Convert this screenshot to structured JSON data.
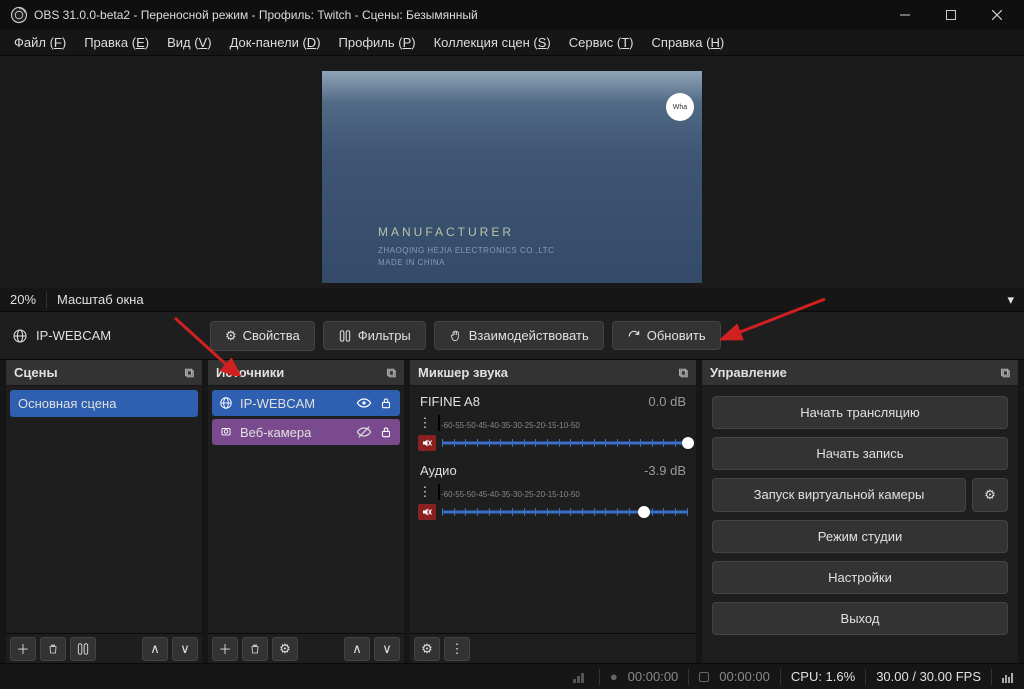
{
  "title": "OBS 31.0.0-beta2 - Переносной режим - Профиль: Twitch - Сцены: Безымянный",
  "menu": [
    "Файл (F)",
    "Правка (E)",
    "Вид (V)",
    "Док-панели (D)",
    "Профиль (P)",
    "Коллекция сцен (S)",
    "Сервис (T)",
    "Справка (H)"
  ],
  "preview": {
    "logo": "Wha",
    "mfr": "MANUFACTURER",
    "sub1": "ZHAOQING HEJIA ELECTRONICS CO.,LTC",
    "sub2": "MADE IN CHINA"
  },
  "zoom": {
    "pct": "20%",
    "label": "Масштаб окна"
  },
  "toolbar": {
    "source": "IP-WEBCAM",
    "props": "Свойства",
    "filters": "Фильтры",
    "interact": "Взаимодействовать",
    "refresh": "Обновить"
  },
  "panels": {
    "scenes": {
      "title": "Сцены",
      "items": [
        "Основная сцена"
      ]
    },
    "sources": {
      "title": "Источники",
      "items": [
        {
          "name": "IP-WEBCAM",
          "type": "web",
          "sel": true
        },
        {
          "name": "Веб-камера",
          "type": "cam",
          "sel": false
        }
      ]
    },
    "mixer": {
      "title": "Микшер звука",
      "channels": [
        {
          "name": "FIFINE A8",
          "db": "0.0 dB",
          "level": 6,
          "vol": 100
        },
        {
          "name": "Аудио",
          "db": "-3.9 dB",
          "level": 0,
          "vol": 82
        }
      ],
      "ticks": [
        "-60",
        "-55",
        "-50",
        "-45",
        "-40",
        "-35",
        "-30",
        "-25",
        "-20",
        "-15",
        "-10",
        "-5",
        "0"
      ]
    },
    "controls": {
      "title": "Управление",
      "buttons": {
        "stream": "Начать трансляцию",
        "record": "Начать запись",
        "vcam": "Запуск виртуальной камеры",
        "studio": "Режим студии",
        "settings": "Настройки",
        "exit": "Выход"
      }
    }
  },
  "status": {
    "rec_time": "00:00:00",
    "live_time": "00:00:00",
    "cpu": "CPU: 1.6%",
    "fps": "30.00 / 30.00 FPS"
  }
}
